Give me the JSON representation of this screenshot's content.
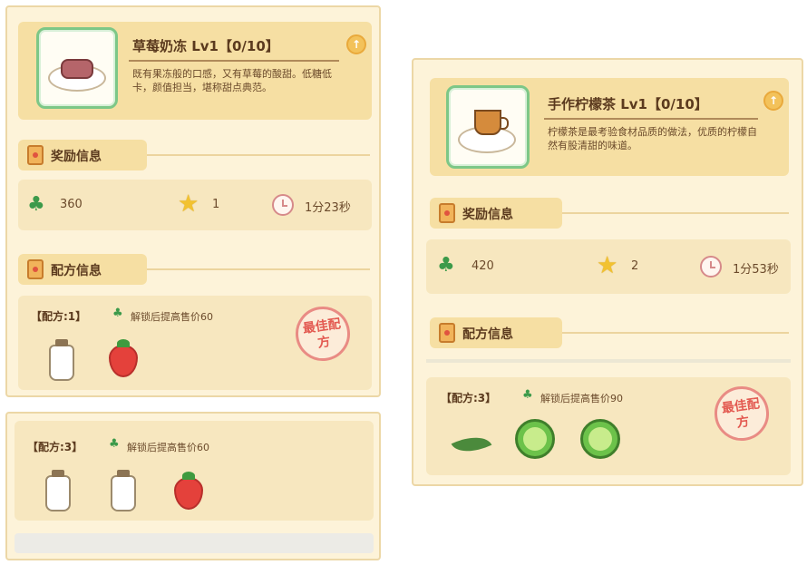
{
  "card_left": {
    "dish_name": "草莓奶冻 Lv1【0/10】",
    "description": "既有果冻般的口感，又有草莓的酸甜。低糖低卡，颜值担当，堪称甜点典范。",
    "reward_section_label": "奖励信息",
    "recipe_section_label": "配方信息",
    "rewards": {
      "clover": "360",
      "star": "1",
      "time": "1分23秒"
    },
    "recipe_1": {
      "label": "【配方:1】",
      "bonus": "解锁后提高售价60",
      "stamp": "最佳配方",
      "ingredients": [
        "milk-bottle",
        "strawberry"
      ]
    },
    "recipe_3": {
      "label": "【配方:3】",
      "bonus": "解锁后提高售价60",
      "ingredients": [
        "milk-bottle",
        "milk-bottle",
        "strawberry"
      ]
    }
  },
  "card_right": {
    "dish_name": "手作柠檬茶 Lv1【0/10】",
    "description": "柠檬茶是最考验食材品质的做法，优质的柠檬自然有股清甜的味道。",
    "reward_section_label": "奖励信息",
    "recipe_section_label": "配方信息",
    "rewards": {
      "clover": "420",
      "star": "2",
      "time": "1分53秒"
    },
    "recipe_3": {
      "label": "【配方:3】",
      "bonus": "解锁后提高售价90",
      "stamp": "最佳配方",
      "ingredients": [
        "tea-leaf",
        "lime",
        "lime"
      ]
    }
  },
  "icons": {
    "upgrade": "upgrade-arrow-icon",
    "clover": "clover-icon",
    "star": "star-icon",
    "clock": "clock-icon",
    "section": "clipboard-icon"
  },
  "colors": {
    "panel_bg": "#fdf3d9",
    "header_bg": "#f6dfa3",
    "thumb_border": "#7dc787",
    "stamp": "#e35b52"
  }
}
